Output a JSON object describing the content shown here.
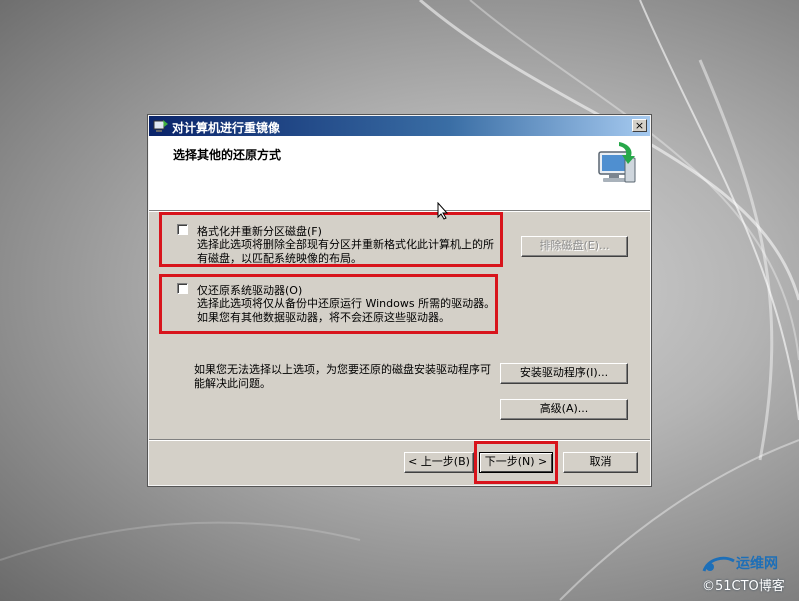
{
  "window": {
    "title": "对计算机进行重镜像",
    "close_glyph": "×"
  },
  "header": {
    "title": "选择其他的还原方式",
    "icon": "computer-restore-icon"
  },
  "options": {
    "format": {
      "label": "格式化并重新分区磁盘(F)",
      "description": "选择此选项将删除全部现有分区并重新格式化此计算机上的所有磁盘，以匹配系统映像的布局。",
      "checked": false
    },
    "restore_system": {
      "label": "仅还原系统驱动器(O)",
      "description": "选择此选项将仅从备份中还原运行 Windows 所需的驱动器。如果您有其他数据驱动器，将不会还原这些驱动器。",
      "checked": false
    }
  },
  "buttons": {
    "exclude_disks": "排除磁盘(E)...",
    "install_drivers": "安装驱动程序(I)...",
    "advanced": "高级(A)...",
    "back": "< 上一步(B)",
    "next": "下一步(N) >",
    "cancel": "取消"
  },
  "hint": "如果您无法选择以上选项，为您要还原的磁盘安装驱动程序可能解决此问题。",
  "watermark": {
    "site_name": "运维网",
    "site_text": "©51CTO博客"
  },
  "colors": {
    "highlight": "#d8141c",
    "titlebar": "#0a246a",
    "dialog_bg": "#d4d0c8"
  }
}
